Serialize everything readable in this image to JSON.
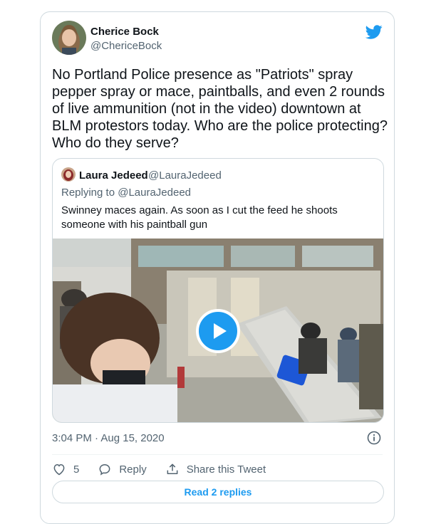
{
  "tweet": {
    "author_name": "Cherice Bock",
    "author_handle": "@ChericeBock",
    "text": "No Portland Police presence as \"Patriots\" spray pepper spray or mace, paintballs, and even 2 rounds of live ammunition (not in the video) downtown at BLM protestors today. Who are the police protecting? Who do they serve?",
    "timestamp": "3:04 PM · Aug 15, 2020",
    "brand_color": "#1d9bf0"
  },
  "quoted": {
    "author_name": "Laura Jedeed",
    "author_handle": "@LauraJedeed",
    "replying_prefix": "Replying to",
    "replying_handle": "@LauraJedeed",
    "text": "Swinney maces again. As soon as I cut the feed he shoots someone with his paintball gun",
    "media_type": "video"
  },
  "actions": {
    "like_count": "5",
    "reply_label": "Reply",
    "share_label": "Share this Tweet"
  },
  "footer": {
    "read_replies_label": "Read 2 replies"
  },
  "icons": {
    "logo": "twitter-bird-icon",
    "info": "info-icon",
    "like": "heart-icon",
    "reply": "reply-bubble-icon",
    "share": "share-icon",
    "play": "play-icon"
  }
}
